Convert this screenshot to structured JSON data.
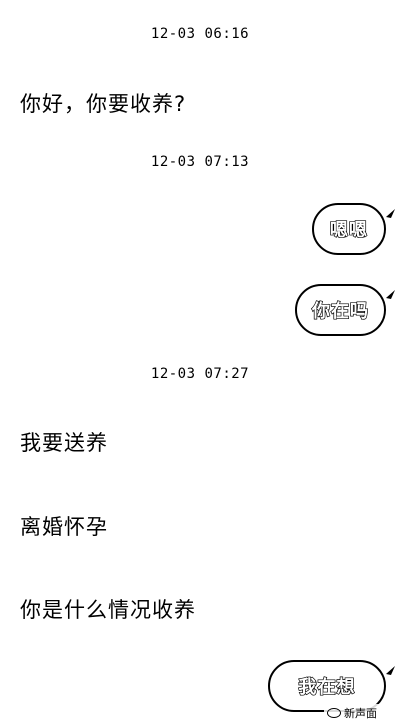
{
  "timestamps": [
    "12-03 06:16",
    "12-03 07:13",
    "12-03 07:27"
  ],
  "incoming": {
    "m1": "你好，你要收养?",
    "m2": "我要送养",
    "m3": "离婚怀孕",
    "m4": "你是什么情况收养"
  },
  "outgoing": {
    "o1": "嗯嗯",
    "o2": "你在吗",
    "o3": "我在想"
  },
  "watermark": "新声面"
}
